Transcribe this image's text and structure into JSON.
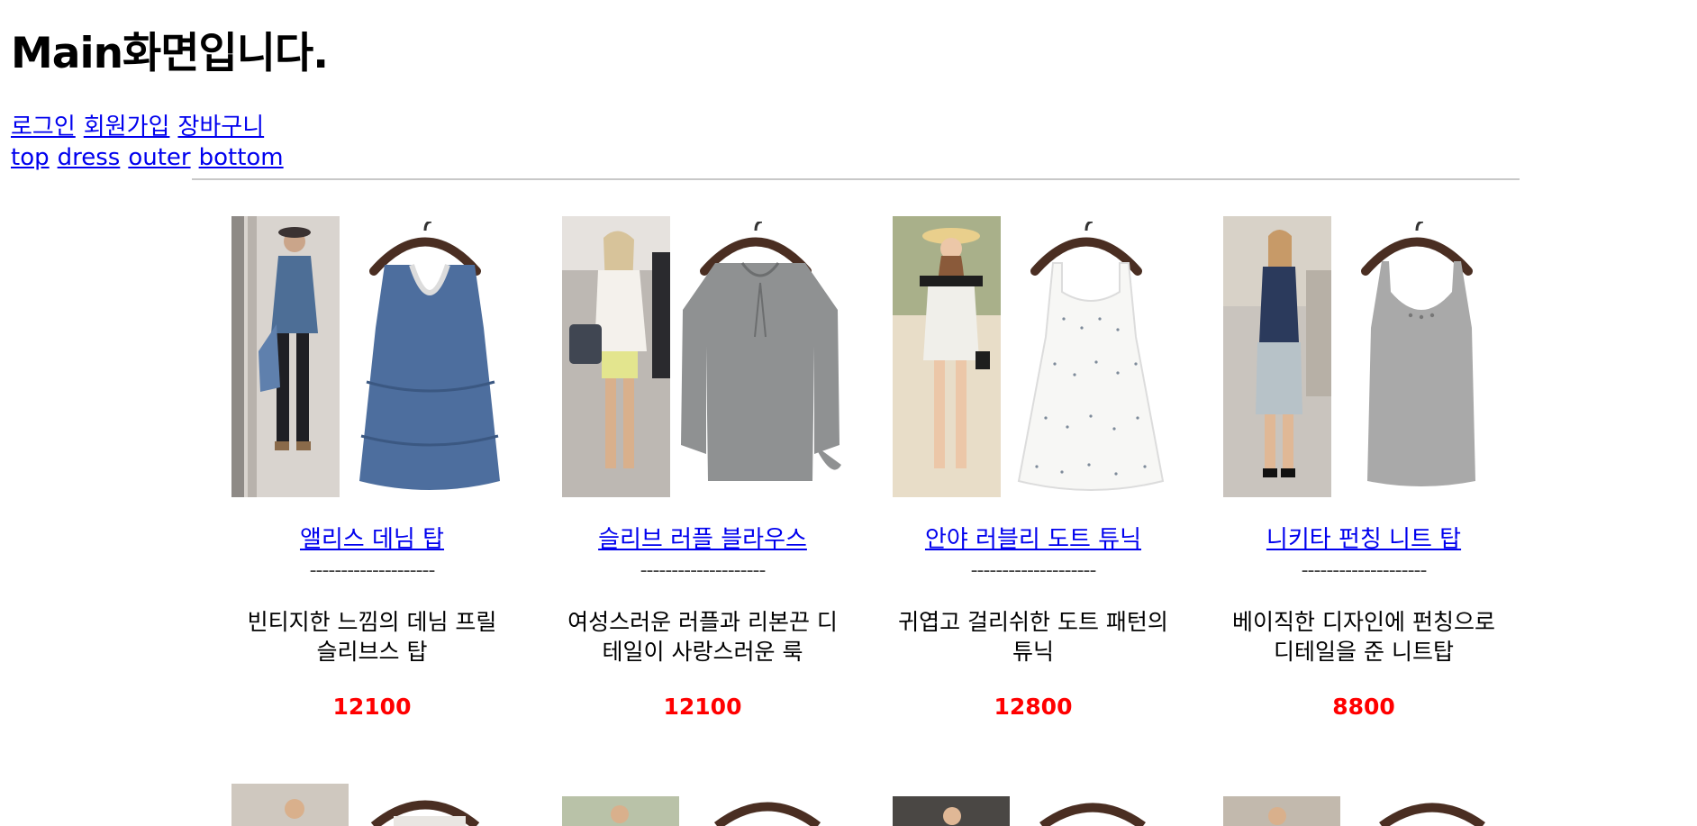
{
  "header": {
    "title": "Main화면입니다."
  },
  "nav": {
    "links": [
      "로그인",
      "회원가입",
      "장바구니"
    ],
    "categories": [
      "top",
      "dress",
      "outer",
      "bottom"
    ]
  },
  "colors": {
    "link": "#0000ee",
    "price": "#ff0000",
    "divider": "#c8c8c8"
  },
  "products": [
    {
      "name": "앨리스 데님 탑",
      "separator": "--------------------",
      "description": "빈티지한 느낌의 데님 프릴 슬리브스 탑",
      "price": "12100",
      "image": "denim-ruffle-top-photo"
    },
    {
      "name": "슬리브 러플 블라우스",
      "separator": "--------------------",
      "description": "여성스러운 러플과 리본끈 디테일이 사랑스러운 룩",
      "price": "12100",
      "image": "grey-ruffle-sleeve-blouse-photo"
    },
    {
      "name": "안야 러블리 도트 튜닉",
      "separator": "--------------------",
      "description": "귀엽고 걸리쉬한 도트 패턴의 튜닉",
      "price": "12800",
      "image": "white-dot-tunic-photo"
    },
    {
      "name": "니키타 펀칭 니트 탑",
      "separator": "--------------------",
      "description": "베이직한 디자인에 펀칭으로 디테일을 준 니트탑",
      "price": "8800",
      "image": "grey-knit-tank-photo"
    }
  ]
}
